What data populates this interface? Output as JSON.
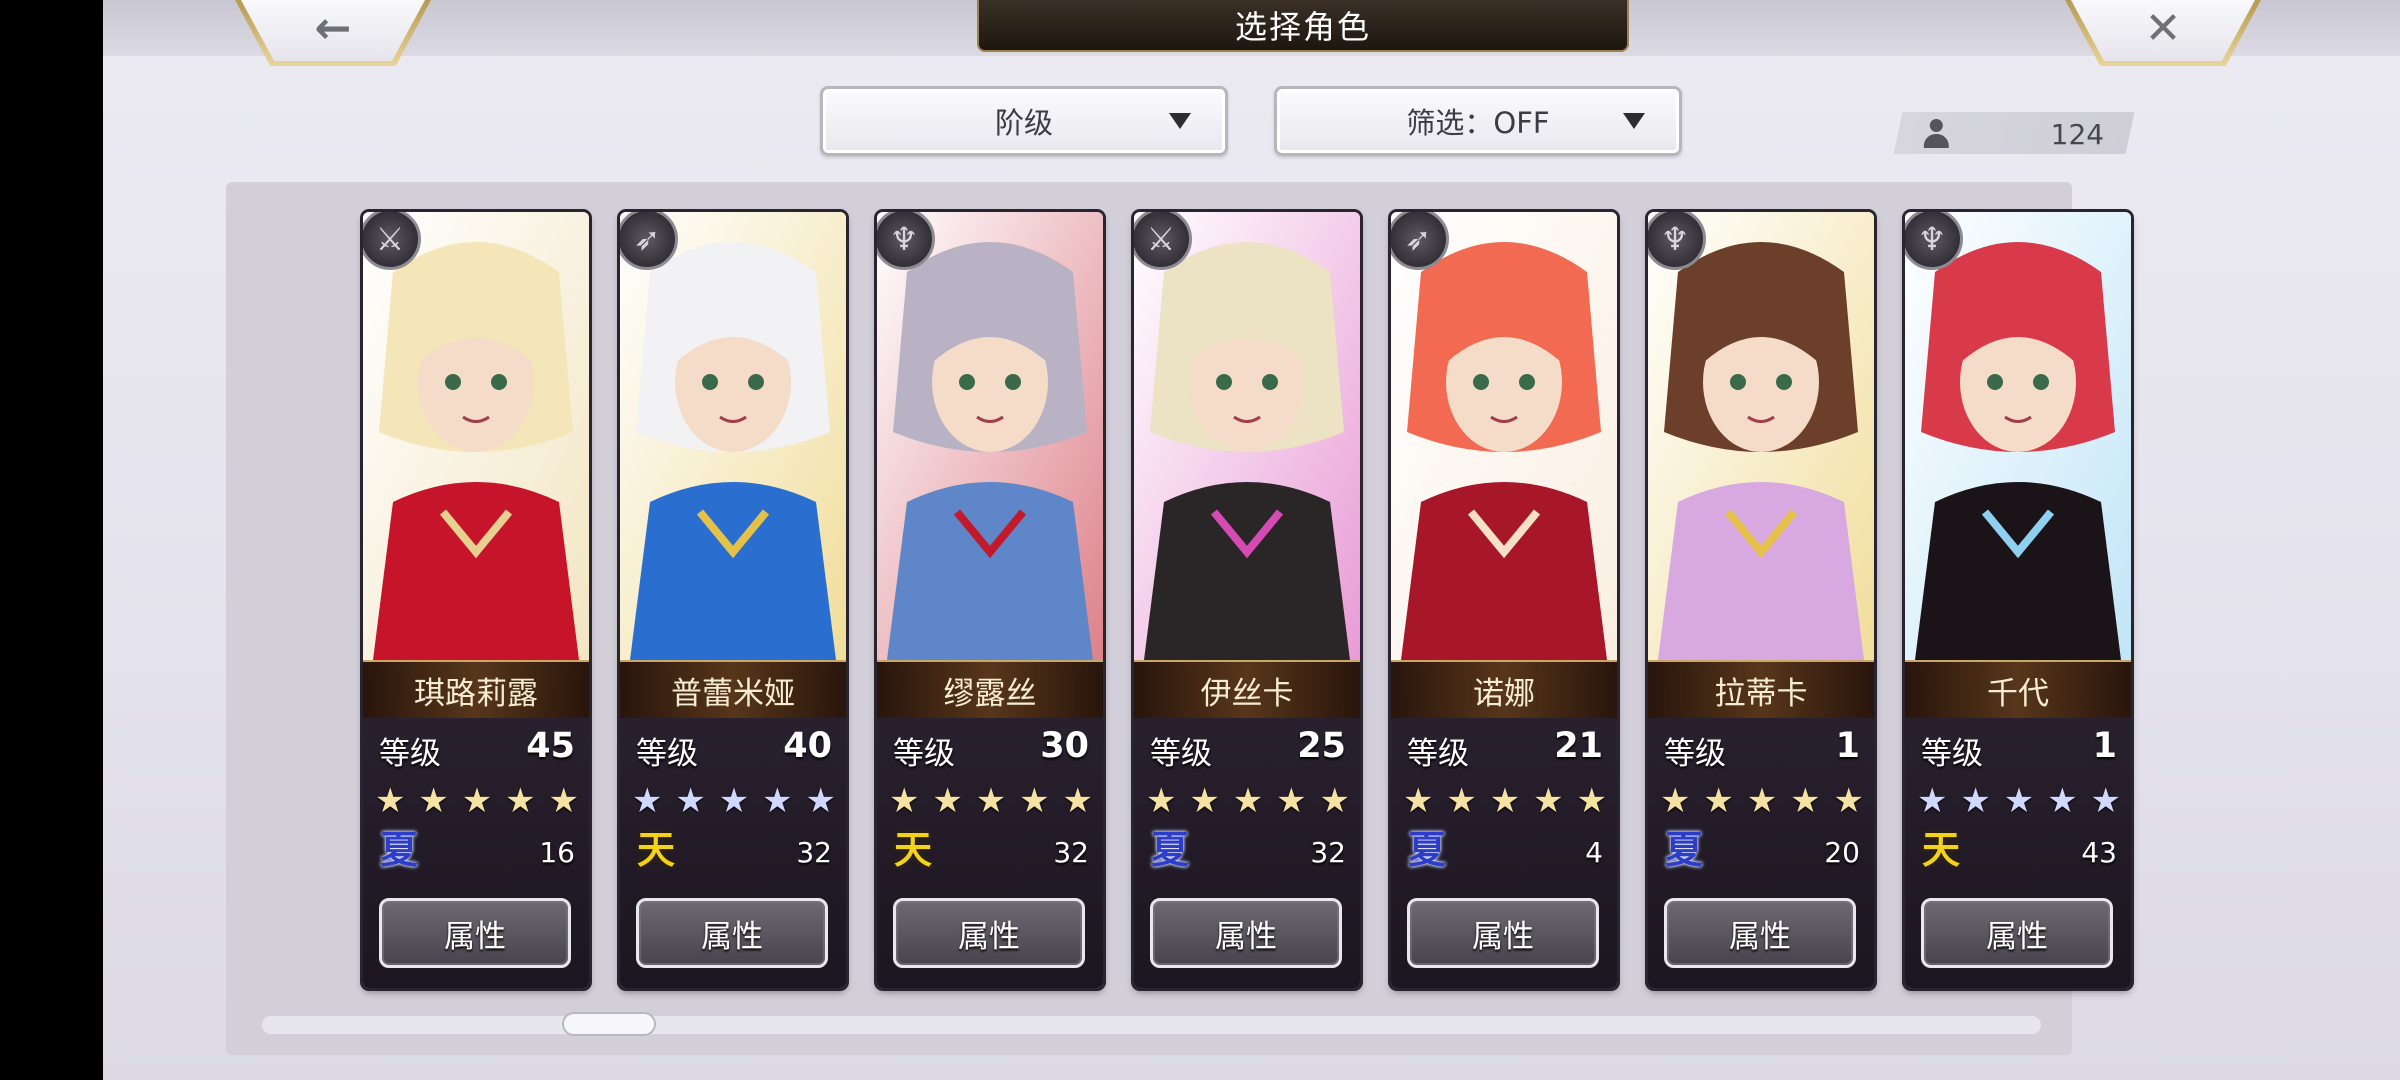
{
  "header": {
    "title": "选择角色",
    "back_icon": "←",
    "close_icon": "✕"
  },
  "filters": {
    "sort_label": "阶级",
    "filter_label": "筛选：OFF"
  },
  "roster_count": "124",
  "characters": [
    {
      "name": "琪路莉露",
      "level_label": "等级",
      "level": "45",
      "stars": "★★★★★",
      "star_color": "gold",
      "element": "夏",
      "element_count": "16",
      "attr_label": "属性",
      "weapon": "sword",
      "colors": [
        "#c6142a",
        "#f4e6b8",
        "#e8d090"
      ]
    },
    {
      "name": "普蕾米娅",
      "level_label": "等级",
      "level": "40",
      "stars": "★★★★★",
      "star_color": "blue",
      "element": "天",
      "element_count": "32",
      "attr_label": "属性",
      "weapon": "bow",
      "colors": [
        "#2a6fd0",
        "#f2f2f4",
        "#e4c24a"
      ]
    },
    {
      "name": "缪露丝",
      "level_label": "等级",
      "level": "30",
      "stars": "★★★★★",
      "star_color": "gold",
      "element": "天",
      "element_count": "32",
      "attr_label": "属性",
      "weapon": "staff",
      "colors": [
        "#5e86c8",
        "#b8b2c4",
        "#c21a2a"
      ]
    },
    {
      "name": "伊丝卡",
      "level_label": "等级",
      "level": "25",
      "stars": "★★★★★",
      "star_color": "gold",
      "element": "夏",
      "element_count": "32",
      "attr_label": "属性",
      "weapon": "blade",
      "colors": [
        "#2a2628",
        "#ece2c4",
        "#d64ab4"
      ]
    },
    {
      "name": "诺娜",
      "level_label": "等级",
      "level": "21",
      "stars": "★★★★★",
      "star_color": "gold",
      "element": "夏",
      "element_count": "4",
      "attr_label": "属性",
      "weapon": "bow",
      "colors": [
        "#a8162a",
        "#f26a52",
        "#f6e0c8"
      ]
    },
    {
      "name": "拉蒂卡",
      "level_label": "等级",
      "level": "1",
      "stars": "★★★★★",
      "star_color": "gold",
      "element": "夏",
      "element_count": "20",
      "attr_label": "属性",
      "weapon": "staff",
      "colors": [
        "#d8a8e0",
        "#6b3f2a",
        "#e6c24a"
      ]
    },
    {
      "name": "千代",
      "level_label": "等级",
      "level": "1",
      "stars": "★★★★★",
      "star_color": "blue",
      "element": "天",
      "element_count": "43",
      "attr_label": "属性",
      "weapon": "staff",
      "colors": [
        "#1a1418",
        "#d83a4a",
        "#8fd0f0"
      ]
    }
  ]
}
